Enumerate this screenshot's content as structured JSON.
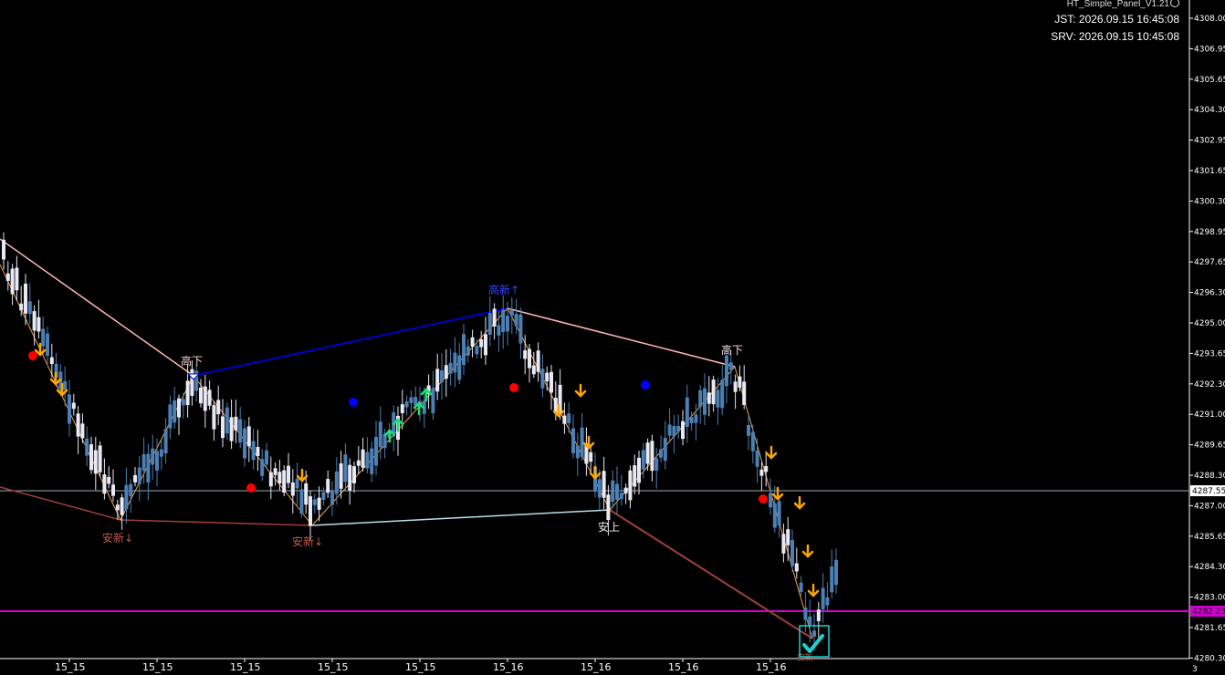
{
  "panel": {
    "title": "HT_Simple_Panel_V1.21",
    "smile_icon": "smiley-icon",
    "jst": "JST: 2026.09.15 16:45:08",
    "srv": "SRV: 2026.09.15 10:45:08"
  },
  "price_axis": {
    "labels": [
      "4308.00",
      "4306.95",
      "4305.65",
      "4304.30",
      "4302.95",
      "4301.65",
      "4300.30",
      "4298.95",
      "4297.65",
      "4296.30",
      "4295.00",
      "4293.65",
      "4292.30",
      "4291.00",
      "4289.65",
      "4288.30",
      "4287.00",
      "4285.65",
      "4284.30",
      "4283.00",
      "4281.65",
      "4280.30"
    ],
    "current_price": "4287.55",
    "support_level": "4282.23"
  },
  "time_axis": {
    "labels": [
      "15_15",
      "15_15",
      "15_15",
      "15_15",
      "15_15",
      "15_16",
      "15_16",
      "15_16",
      "15_16"
    ],
    "corner": "3"
  },
  "swing_labels": [
    "高下",
    "高新↑",
    "高下",
    "安新↓",
    "安新↓",
    "安上",
    "安新"
  ],
  "colors": {
    "background": "#000000",
    "bull_candle": "#4c7fb4",
    "bear_candle": "#e8e8f4",
    "zigzag": "#f0a050",
    "upper_line_pink": "#ffb6b6",
    "upper_line_blue": "#0000cc",
    "lower_line_brown": "#a0403a",
    "lower_line_light": "#b8e0e8",
    "support_line": "#d000d0",
    "price_line": "#9aa8b8",
    "arrow_orange": "#ffa500",
    "arrow_green": "#22dd77",
    "dot_red": "#ff0000",
    "dot_blue": "#0000ff",
    "check_cyan": "#20d0d0"
  },
  "markers": {
    "sell_arrow_icon": "down-arrow-icon",
    "buy_arrow_icon": "up-arrow-icon",
    "red_dot_icon": "red-dot-icon",
    "blue_dot_icon": "blue-dot-icon",
    "check_icon": "checkmark-icon"
  }
}
